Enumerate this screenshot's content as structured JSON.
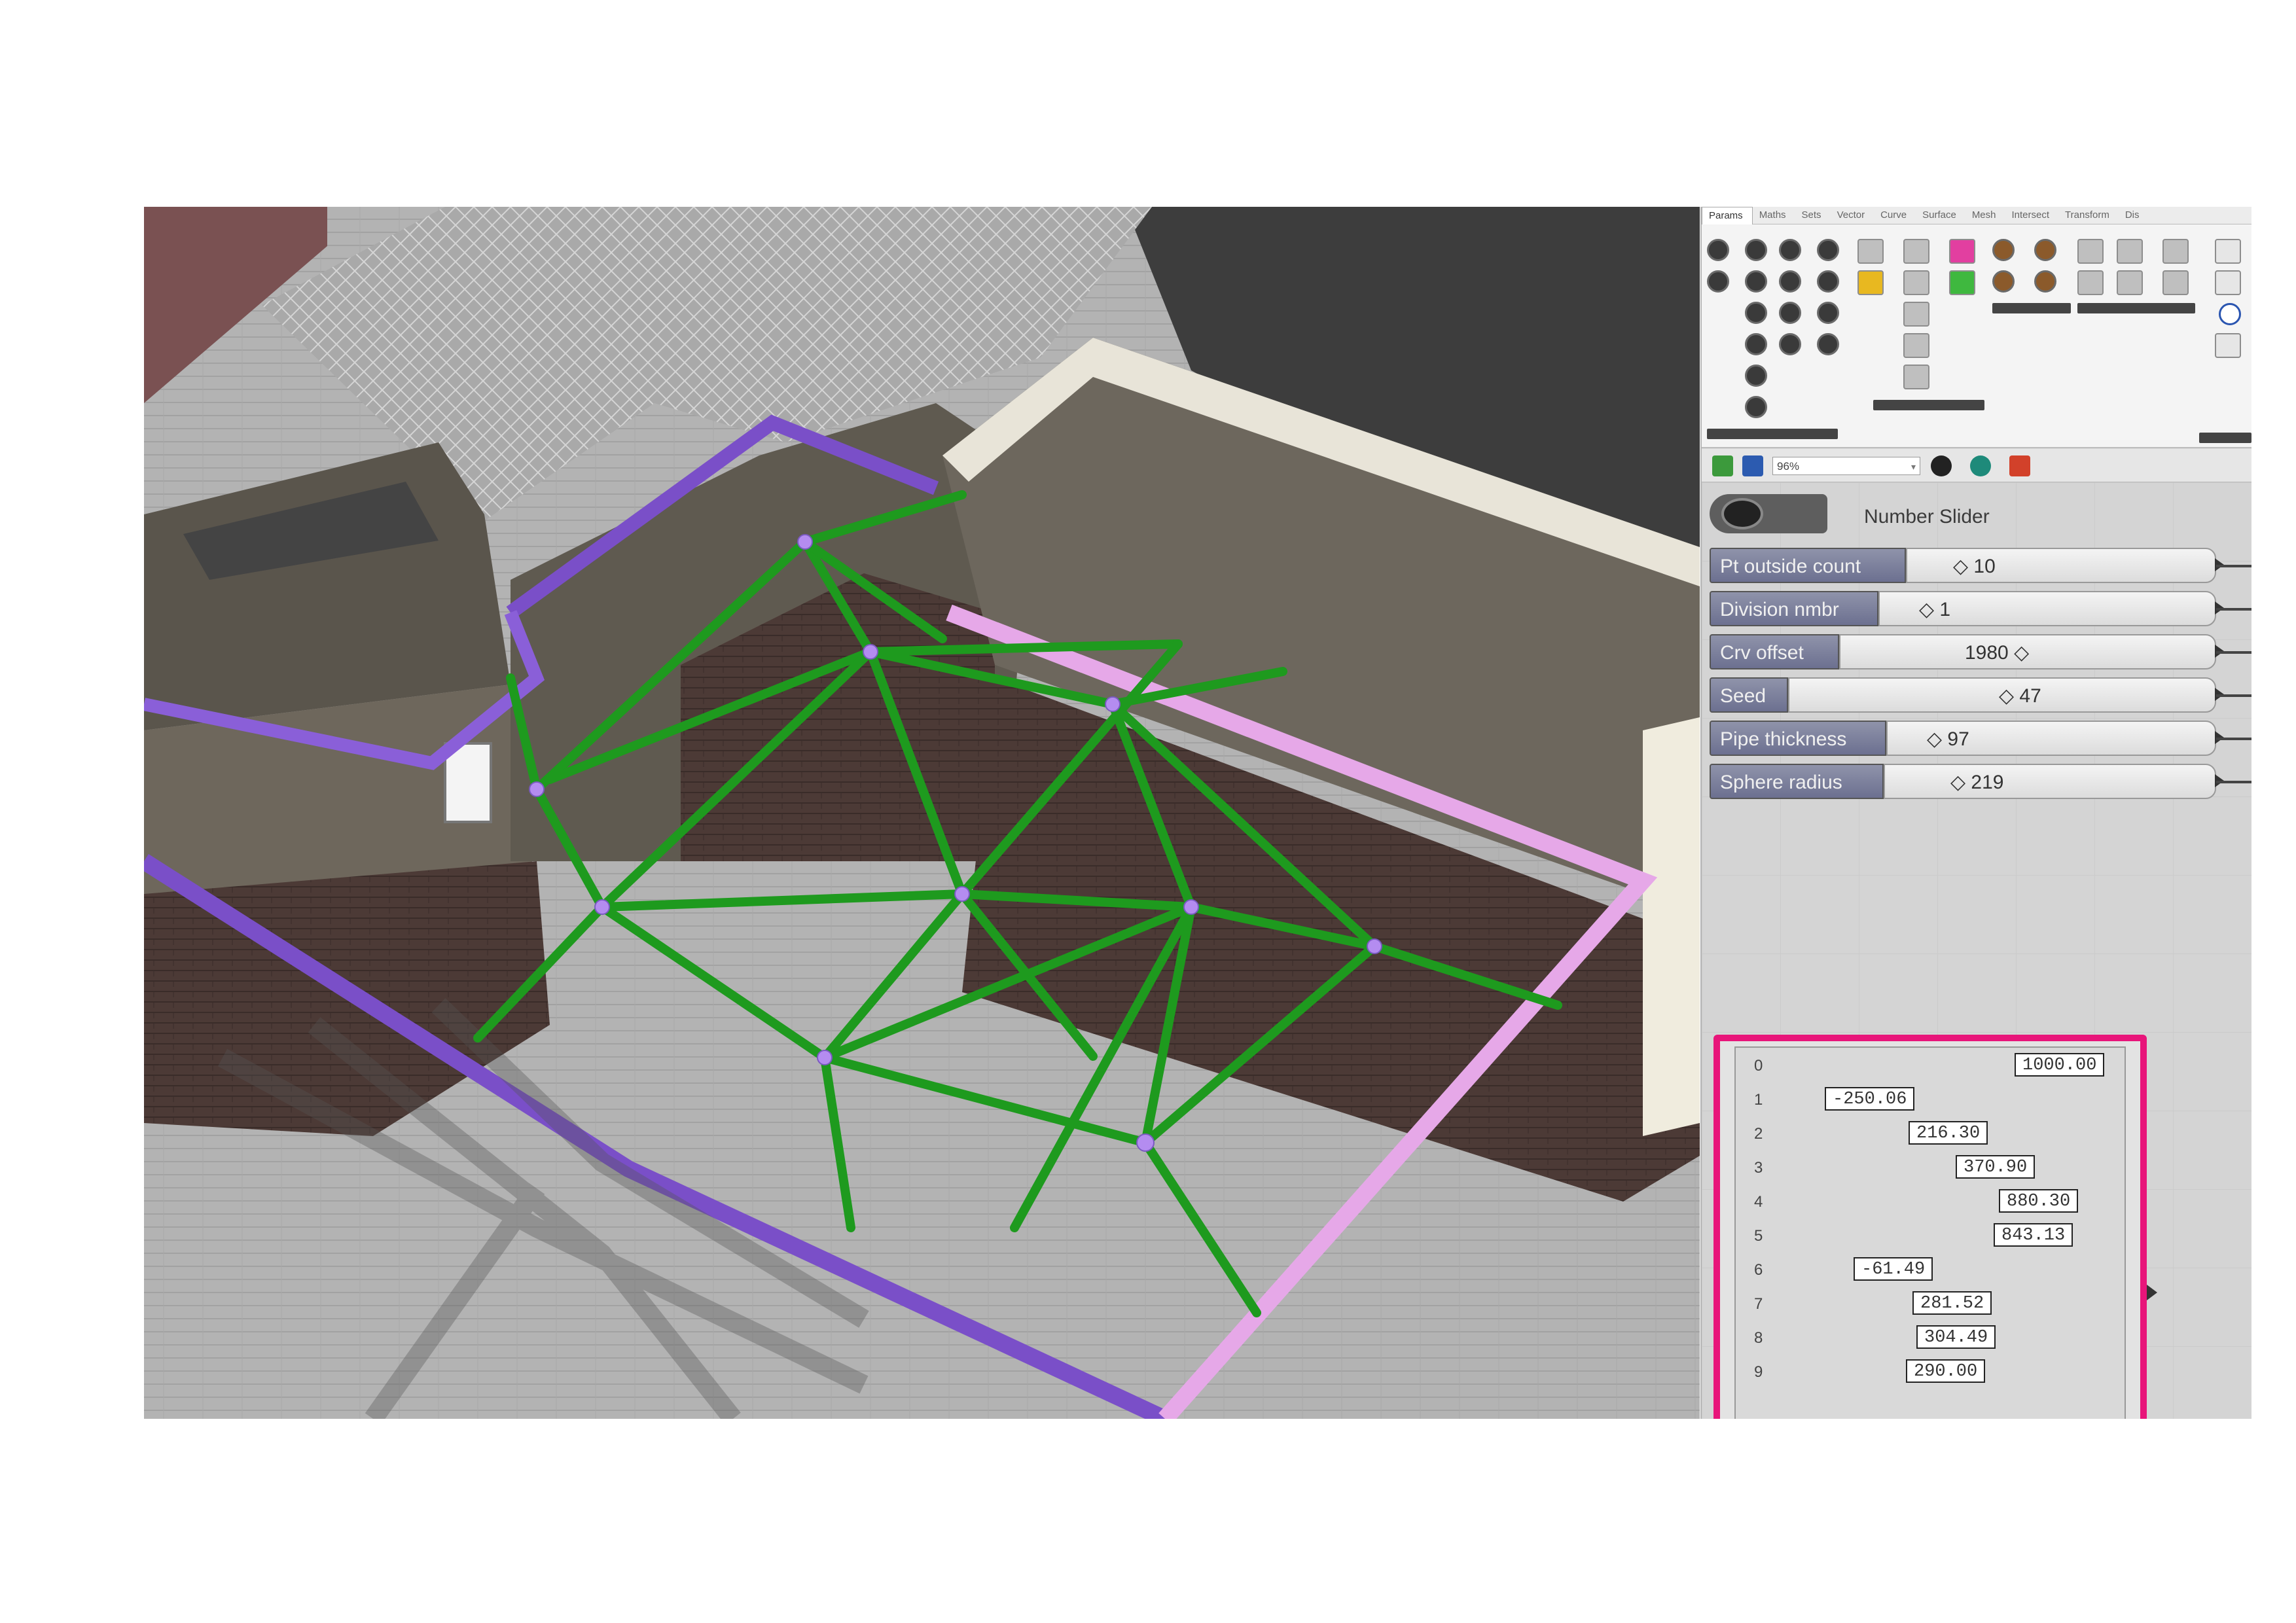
{
  "gh": {
    "tabs": [
      "Params",
      "Maths",
      "Sets",
      "Vector",
      "Curve",
      "Surface",
      "Mesh",
      "Intersect",
      "Transform",
      "Dis"
    ],
    "zoom": "96%"
  },
  "slider_component": {
    "title": "Number Slider",
    "sliders": [
      {
        "label": "Pt outside count",
        "value": "10",
        "display": "◇ 10"
      },
      {
        "label": "Division nmbr",
        "value": "1",
        "display": "◇ 1"
      },
      {
        "label": "Crv offset",
        "value": "1980",
        "display": "1980 ◇"
      },
      {
        "label": "Seed",
        "value": "47",
        "display": "◇ 47"
      },
      {
        "label": "Pipe thickness",
        "value": "97",
        "display": "◇ 97"
      },
      {
        "label": "Sphere radius",
        "value": "219",
        "display": "◇ 219"
      }
    ]
  },
  "panel": {
    "rows": [
      {
        "index": "0",
        "value": "1000.00"
      },
      {
        "index": "1",
        "value": "-250.06"
      },
      {
        "index": "2",
        "value": "216.30"
      },
      {
        "index": "3",
        "value": "370.90"
      },
      {
        "index": "4",
        "value": "880.30"
      },
      {
        "index": "5",
        "value": "843.13"
      },
      {
        "index": "6",
        "value": "-61.49"
      },
      {
        "index": "7",
        "value": "281.52"
      },
      {
        "index": "8",
        "value": "304.49"
      },
      {
        "index": "9",
        "value": "290.00"
      }
    ]
  },
  "colors": {
    "structure": "#1e9a1e",
    "node": "#b48cf0",
    "boundary": "#7a4fc8",
    "panel_border": "#e8157a"
  }
}
